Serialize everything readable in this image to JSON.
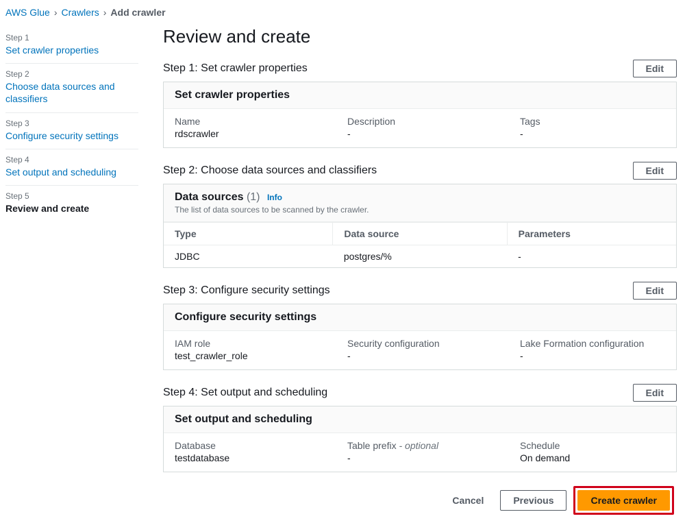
{
  "breadcrumb": {
    "root": "AWS Glue",
    "mid": "Crawlers",
    "current": "Add crawler"
  },
  "sidebar": {
    "steps": [
      {
        "num": "Step 1",
        "label": "Set crawler properties",
        "active": false
      },
      {
        "num": "Step 2",
        "label": "Choose data sources and classifiers",
        "active": false
      },
      {
        "num": "Step 3",
        "label": "Configure security settings",
        "active": false
      },
      {
        "num": "Step 4",
        "label": "Set output and scheduling",
        "active": false
      },
      {
        "num": "Step 5",
        "label": "Review and create",
        "active": true
      }
    ]
  },
  "page_title": "Review and create",
  "common": {
    "edit": "Edit",
    "dash": "-",
    "info": "Info"
  },
  "step1": {
    "heading": "Step 1: Set crawler properties",
    "panel_title": "Set crawler properties",
    "props": {
      "name_label": "Name",
      "name_value": "rdscrawler",
      "desc_label": "Description",
      "tags_label": "Tags"
    }
  },
  "step2": {
    "heading": "Step 2: Choose data sources and classifiers",
    "panel_title": "Data sources",
    "count": "(1)",
    "subhead": "The list of data sources to be scanned by the crawler.",
    "columns": {
      "type": "Type",
      "data_source": "Data source",
      "parameters": "Parameters"
    },
    "rows": [
      {
        "type": "JDBC",
        "data_source": "postgres/%",
        "parameters": "-"
      }
    ]
  },
  "step3": {
    "heading": "Step 3: Configure security settings",
    "panel_title": "Configure security settings",
    "props": {
      "iam_label": "IAM role",
      "iam_value": "test_crawler_role",
      "sec_cfg_label": "Security configuration",
      "lake_label": "Lake Formation configuration"
    }
  },
  "step4": {
    "heading": "Step 4: Set output and scheduling",
    "panel_title": "Set output and scheduling",
    "props": {
      "db_label": "Database",
      "db_value": "testdatabase",
      "prefix_label": "Table prefix",
      "prefix_hint": " - optional",
      "schedule_label": "Schedule",
      "schedule_value": "On demand"
    }
  },
  "footer": {
    "cancel": "Cancel",
    "previous": "Previous",
    "create": "Create crawler"
  }
}
